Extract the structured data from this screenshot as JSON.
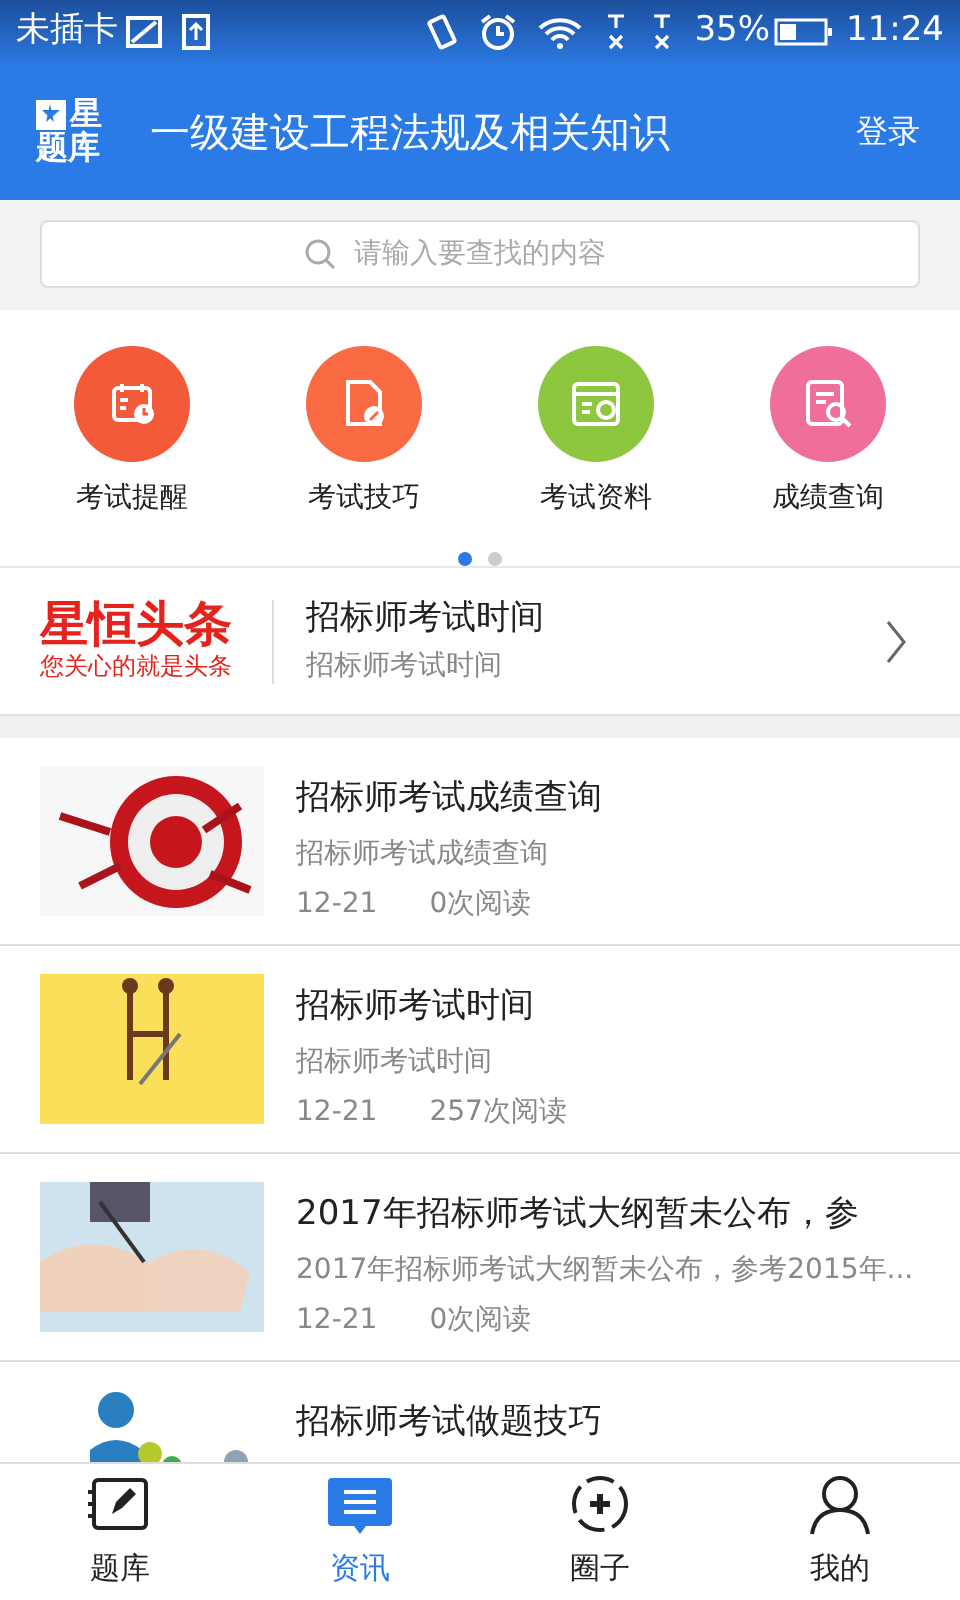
{
  "status_bar": {
    "carrier": "未插卡",
    "battery": "35%",
    "time": "11:24"
  },
  "header": {
    "logo_line1": "星",
    "logo_line2": "题库",
    "title": "一级建设工程法规及相关知识",
    "login": "登录"
  },
  "search": {
    "placeholder": "请输入要查找的内容"
  },
  "categories": [
    {
      "label": "考试提醒",
      "kind": "calendar",
      "color": "#f25a3a"
    },
    {
      "label": "考试技巧",
      "kind": "document",
      "color": "#fb6b43"
    },
    {
      "label": "考试资料",
      "kind": "profile",
      "color": "#8dc63f"
    },
    {
      "label": "成绩查询",
      "kind": "search",
      "color": "#f06e9c"
    }
  ],
  "pager": [
    {
      "selected": true
    },
    {
      "selected": false
    }
  ],
  "headline": {
    "brand": "星恒头条",
    "slogan": "您关心的就是头条",
    "title": "招标师考试时间",
    "subtitle": "招标师考试时间"
  },
  "articles": [
    {
      "kind": "target",
      "title": "招标师考试成绩查询",
      "subtitle": "招标师考试成绩查询",
      "date": "12-21",
      "reads": "0次阅读"
    },
    {
      "kind": "handshake",
      "title": "招标师考试时间",
      "subtitle": "招标师考试时间",
      "date": "12-21",
      "reads": "257次阅读"
    },
    {
      "kind": "writing",
      "title": "2017年招标师考试大纲暂未公布，参",
      "subtitle": "2017年招标师考试大纲暂未公布，参考2015年...",
      "date": "12-21",
      "reads": "0次阅读"
    },
    {
      "kind": "people",
      "title": "招标师考试做题技巧"
    }
  ],
  "tabs": [
    {
      "label": "题库",
      "kind": "book",
      "selected": false
    },
    {
      "label": "资讯",
      "kind": "news",
      "selected": true
    },
    {
      "label": "圈子",
      "kind": "circle",
      "selected": false
    },
    {
      "label": "我的",
      "kind": "person",
      "selected": false
    }
  ]
}
